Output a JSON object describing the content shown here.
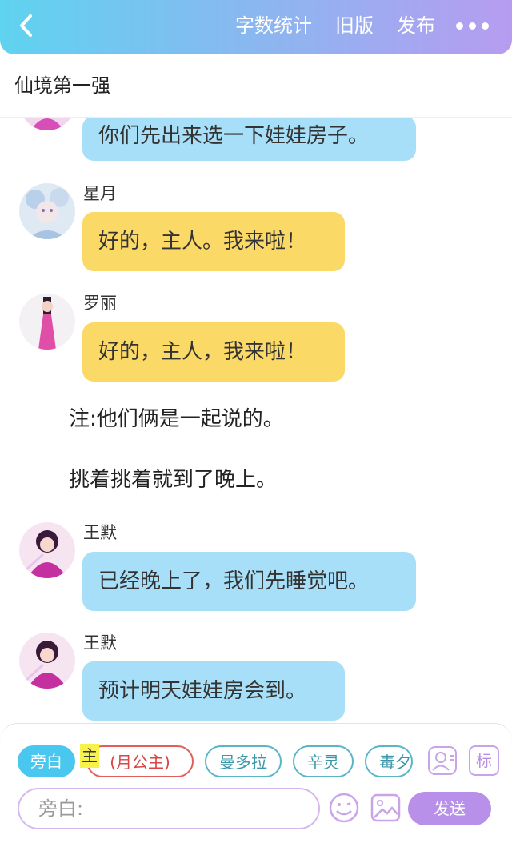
{
  "topbar": {
    "word_count": "字数统计",
    "old_version": "旧版",
    "publish": "发布"
  },
  "page_title": "仙境第一强",
  "messages": [
    {
      "name": "",
      "text": "你们先出来选一下娃娃房子。",
      "color": "blue"
    },
    {
      "name": "星月",
      "text": "好的，主人。我来啦！",
      "color": "yellow"
    },
    {
      "name": "罗丽",
      "text": "好的，主人，我来啦！",
      "color": "yellow"
    },
    {
      "name": "王默",
      "text": "已经晚上了，我们先睡觉吧。",
      "color": "blue"
    },
    {
      "name": "王默",
      "text": "预计明天娃娃房会到。",
      "color": "blue"
    }
  ],
  "notes": [
    "注:他们俩是一起说的。",
    "挑着挑着就到了晚上。"
  ],
  "roles": {
    "aside": "旁白",
    "tag": "主",
    "moon": "(月公主)",
    "man": "曼多拉",
    "xin": "辛灵",
    "du": "毒夕",
    "mark": "标"
  },
  "composer": {
    "placeholder": "旁白:",
    "send": "发送"
  },
  "colors": {
    "bubble_blue": "#a8dff8",
    "bubble_yellow": "#fbd967",
    "accent_purple": "#b890ea"
  }
}
